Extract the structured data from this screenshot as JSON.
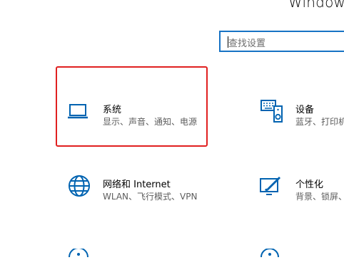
{
  "window": {
    "title": "Windows"
  },
  "search": {
    "placeholder": "查找设置"
  },
  "tiles": [
    {
      "name": "系统",
      "desc": "显示、声音、通知、电源",
      "icon": "laptop-icon"
    },
    {
      "name": "设备",
      "desc": "蓝牙、打印机",
      "icon": "keyboard-speaker-icon"
    },
    {
      "name": "网络和 Internet",
      "desc": "WLAN、飞行模式、VPN",
      "icon": "globe-icon"
    },
    {
      "name": "个性化",
      "desc": "背景、锁屏、",
      "icon": "paint-brush-icon"
    }
  ],
  "colors": {
    "accent": "#0063b1",
    "highlight": "#e02020",
    "search_border": "#1773c4"
  }
}
